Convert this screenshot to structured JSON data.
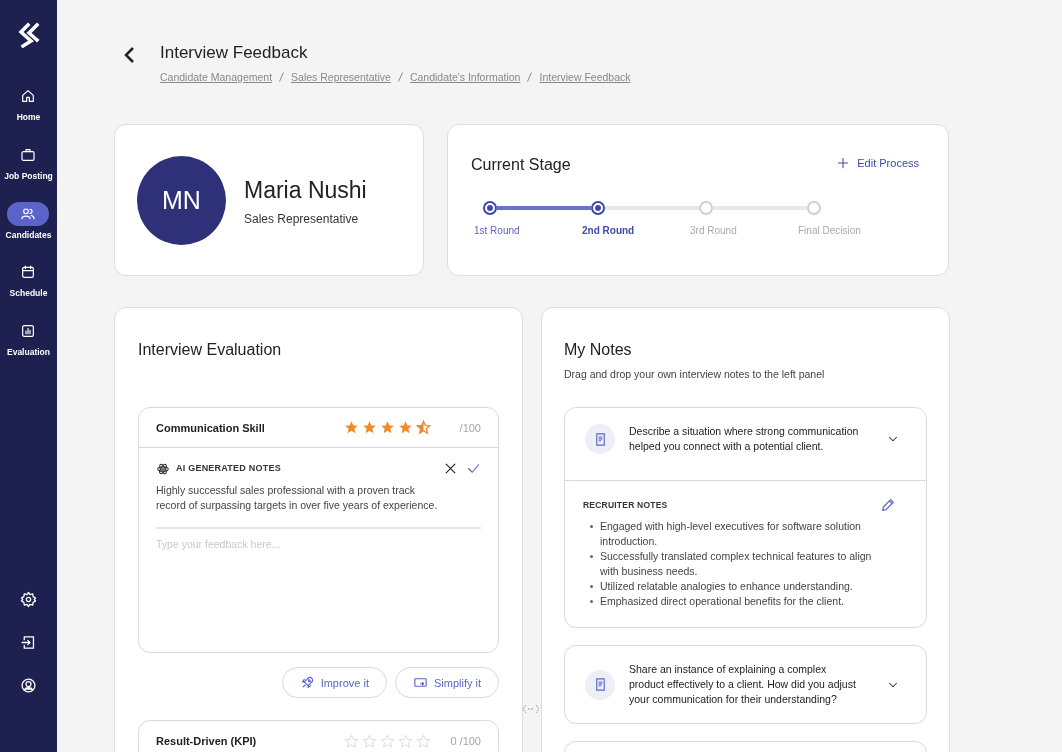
{
  "sidebar": {
    "items": [
      {
        "label": "Home",
        "selected": false
      },
      {
        "label": "Job Posting",
        "selected": false
      },
      {
        "label": "Candidates",
        "selected": true
      },
      {
        "label": "Schedule",
        "selected": false
      },
      {
        "label": "Evaluation",
        "selected": false
      }
    ]
  },
  "header": {
    "title": "Interview Feedback",
    "breadcrumb": [
      "Candidate Management",
      "Sales Representative",
      "Candidate's Information",
      "Interview Feedback"
    ]
  },
  "profile": {
    "initials": "MN",
    "name": "Maria Nushi",
    "role": "Sales Representative"
  },
  "stage": {
    "title": "Current Stage",
    "action": "Edit Process",
    "steps": [
      {
        "label": "1st Round",
        "done": true,
        "selected": false
      },
      {
        "label": "2nd Round",
        "done": true,
        "selected": true
      },
      {
        "label": "3rd Round",
        "done": false,
        "selected": false
      },
      {
        "label": "Final Decision",
        "done": false,
        "selected": false
      }
    ]
  },
  "evaluation": {
    "title": "Interview Evaluation",
    "criteria": [
      {
        "name": "Communication Skill",
        "stars": 4.5,
        "score": "/100",
        "expanded": true,
        "ai_label": "AI GENERATED NOTES",
        "ai_text": "Highly successful sales professional with a proven track record of surpassing targets in over five years of experience.",
        "placeholder": "Type your feedback here...",
        "buttons": [
          "Improve it",
          "Simplify it"
        ]
      },
      {
        "name": "Result-Driven (KPI)",
        "stars": 0,
        "score": "0 /100",
        "expanded": false
      }
    ]
  },
  "notes": {
    "title": "My Notes",
    "subtitle": "Drag and drop your own interview notes to the left panel",
    "questions": [
      {
        "kind": "question",
        "text": "Describe a situation where strong communication helped you connect with a potential client.",
        "expanded": true,
        "notes_label": "RECRUITER NOTES",
        "notes": [
          "Engaged with high-level executives for software solution introduction.",
          "Successfully translated complex technical features to align with business needs.",
          "Utilized relatable analogies to enhance understanding.",
          "Emphasized direct operational benefits for the client."
        ]
      },
      {
        "kind": "question",
        "text": "Share an instance of explaining a complex product effectively to a client. How did you adjust your communication for their understanding?",
        "expanded": false
      },
      {
        "kind": "cut"
      }
    ]
  }
}
